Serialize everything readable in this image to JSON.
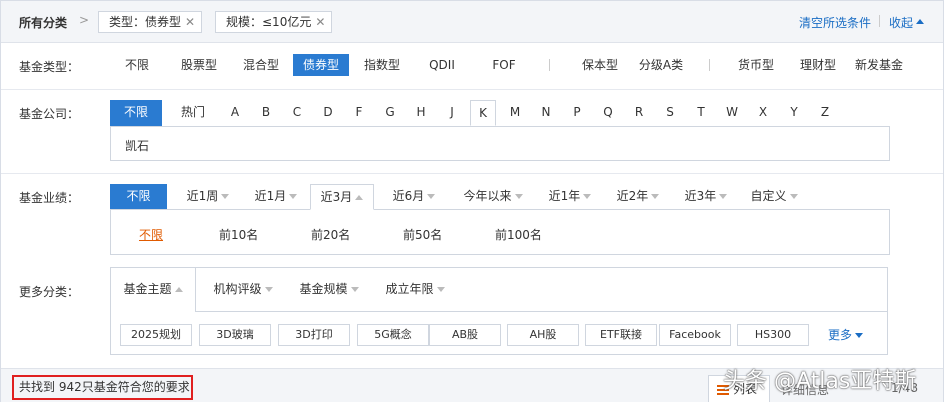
{
  "topbar": {
    "title": "所有分类",
    "arrow": ">",
    "chips": [
      {
        "label": "类型：债券型",
        "close": "✕"
      },
      {
        "label": "规模：≤10亿元",
        "close": "✕"
      }
    ],
    "clear": "清空所选条件",
    "collapse": "收起"
  },
  "fund_type": {
    "label": "基金类型：",
    "options": [
      "不限",
      "股票型",
      "混合型",
      "债券型",
      "指数型",
      "QDII",
      "FOF",
      "保本型",
      "分级A类",
      "货币型",
      "理财型",
      "新发基金"
    ],
    "active": "债券型"
  },
  "fund_company": {
    "label": "基金公司：",
    "tabs": [
      "不限",
      "热门",
      "A",
      "B",
      "C",
      "D",
      "F",
      "G",
      "H",
      "J",
      "K",
      "M",
      "N",
      "P",
      "Q",
      "R",
      "S",
      "T",
      "W",
      "X",
      "Y",
      "Z"
    ],
    "active": "不限",
    "selected_letter": "K",
    "items": [
      "凯石"
    ]
  },
  "performance": {
    "label": "基金业绩：",
    "tabs": [
      "不限",
      "近1周",
      "近1月",
      "近3月",
      "近6月",
      "今年以来",
      "近1年",
      "近2年",
      "近3年",
      "自定义"
    ],
    "active": "不限",
    "opened": "近3月",
    "ranks": [
      "不限",
      "前10名",
      "前20名",
      "前50名",
      "前100名"
    ],
    "selected_rank": "不限"
  },
  "more": {
    "label": "更多分类：",
    "tabs": [
      "基金主题",
      "机构评级",
      "基金规模",
      "成立年限"
    ],
    "active": "基金主题",
    "tags": [
      "2025规划",
      "3D玻璃",
      "3D打印",
      "5G概念",
      "AB股",
      "AH股",
      "ETF联接",
      "Facebook",
      "HS300"
    ],
    "more_link": "更多"
  },
  "bottom": {
    "result": "共找到 942只基金符合您的要求",
    "view_list": "列表",
    "view_detail": "详细信息",
    "view_extra": "1/48"
  },
  "watermark": "头条 @Atlas亚特斯"
}
